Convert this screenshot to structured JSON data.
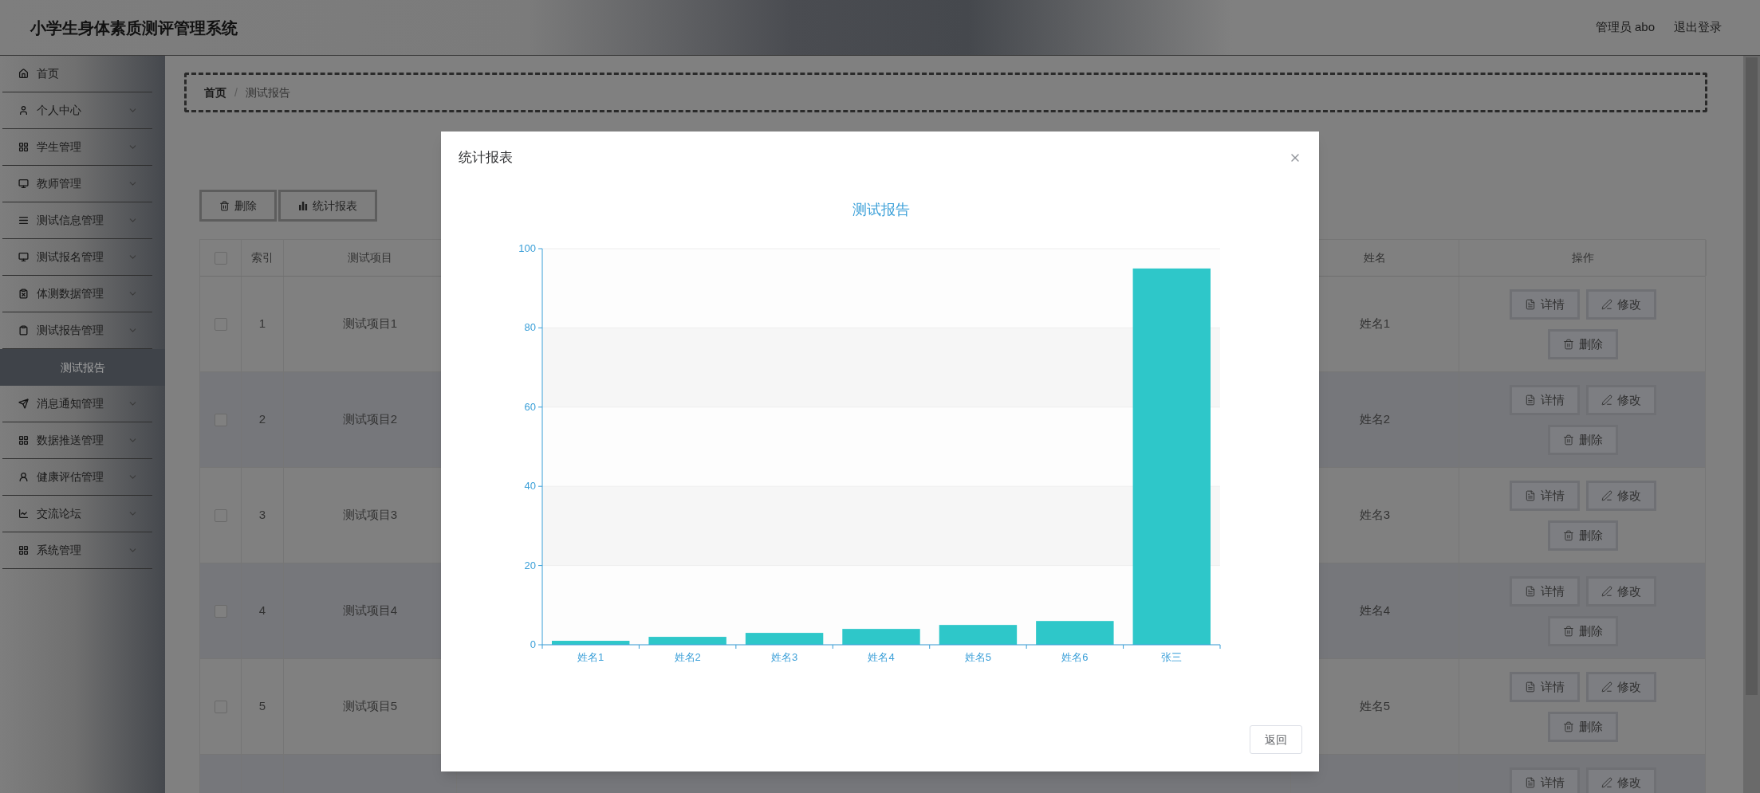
{
  "header": {
    "title": "小学生身体素质测评管理系统",
    "user": "管理员 abo",
    "logout": "退出登录"
  },
  "sidebar": {
    "items": [
      {
        "label": "首页",
        "kind": "link",
        "selected": false
      },
      {
        "label": "个人中心",
        "kind": "submenu",
        "selected": false
      },
      {
        "label": "学生管理",
        "kind": "submenu",
        "selected": false
      },
      {
        "label": "教师管理",
        "kind": "submenu",
        "selected": false
      },
      {
        "label": "测试信息管理",
        "kind": "submenu",
        "selected": false
      },
      {
        "label": "测试报名管理",
        "kind": "submenu",
        "selected": false
      },
      {
        "label": "体测数据管理",
        "kind": "submenu",
        "selected": false
      },
      {
        "label": "测试报告管理",
        "kind": "submenu",
        "selected": false,
        "children": [
          {
            "label": "测试报告",
            "selected": true
          }
        ]
      },
      {
        "label": "消息通知管理",
        "kind": "submenu",
        "selected": false
      },
      {
        "label": "数据推送管理",
        "kind": "submenu",
        "selected": false
      },
      {
        "label": "健康评估管理",
        "kind": "submenu",
        "selected": false
      },
      {
        "label": "交流论坛",
        "kind": "submenu",
        "selected": false
      },
      {
        "label": "系统管理",
        "kind": "submenu",
        "selected": false
      }
    ]
  },
  "breadcrumb": {
    "items": [
      "首页",
      "测试报告"
    ],
    "separator": "/"
  },
  "toolbar": {
    "buttons": [
      {
        "label": "删除",
        "kind": "delete"
      },
      {
        "label": "统计报表",
        "kind": "report"
      }
    ]
  },
  "table": {
    "header_checked": false,
    "columns": [
      "索引",
      "测试项目",
      "姓名",
      "操作"
    ],
    "rows": [
      {
        "checked": false,
        "index": "1",
        "item": "测试项目1",
        "name": "姓名1",
        "actions": [
          "详情",
          "修改",
          "删除"
        ]
      },
      {
        "checked": false,
        "index": "2",
        "item": "测试项目2",
        "name": "姓名2",
        "actions": [
          "详情",
          "修改",
          "删除"
        ]
      },
      {
        "checked": false,
        "index": "3",
        "item": "测试项目3",
        "name": "姓名3",
        "actions": [
          "详情",
          "修改",
          "删除"
        ]
      },
      {
        "checked": false,
        "index": "4",
        "item": "测试项目4",
        "name": "姓名4",
        "actions": [
          "详情",
          "修改",
          "删除"
        ]
      },
      {
        "checked": false,
        "index": "5",
        "item": "测试项目5",
        "name": "姓名5",
        "actions": [
          "详情",
          "修改",
          "删除"
        ]
      },
      {
        "actions": [
          "详情",
          "修改"
        ]
      }
    ]
  },
  "modal": {
    "title": "统计报表",
    "footer_button": "返回",
    "chart_data": {
      "type": "bar",
      "title": "测试报告",
      "categories": [
        "姓名1",
        "姓名2",
        "姓名3",
        "姓名4",
        "姓名5",
        "姓名6",
        "张三"
      ],
      "grid": true,
      "series": [
        {
          "color": "#2ec7c9",
          "values": [
            1,
            2,
            3,
            4,
            5,
            6,
            95
          ]
        }
      ],
      "ylim": [
        0,
        100
      ],
      "yticks": [
        0,
        20,
        40,
        60,
        80,
        100
      ]
    }
  }
}
